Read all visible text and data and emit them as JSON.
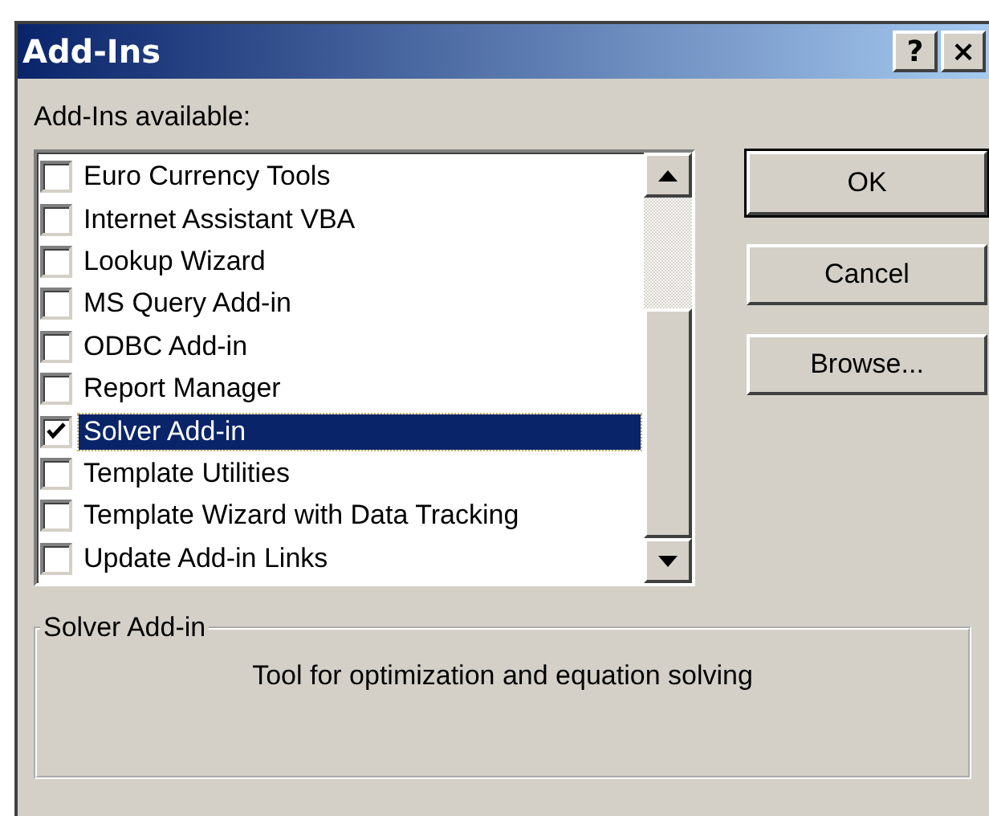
{
  "window": {
    "title": "Add-Ins",
    "title_buttons": [
      "?",
      "×"
    ]
  },
  "list_label": {
    "text": "Add-Ins available:"
  },
  "addins": [
    {
      "name": "Euro Currency Tools",
      "checked": false,
      "selected": false
    },
    {
      "name": "Internet Assistant VBA",
      "checked": false,
      "selected": false
    },
    {
      "name": "Lookup Wizard",
      "checked": false,
      "selected": false
    },
    {
      "name": "MS Query Add-in",
      "checked": false,
      "selected": false
    },
    {
      "name": "ODBC Add-in",
      "checked": false,
      "selected": false
    },
    {
      "name": "Report Manager",
      "checked": false,
      "selected": false
    },
    {
      "name": "Solver Add-in",
      "checked": true,
      "selected": true
    },
    {
      "name": "Template Utilities",
      "checked": false,
      "selected": false
    },
    {
      "name": "Template Wizard with Data Tracking",
      "checked": false,
      "selected": false
    },
    {
      "name": "Update Add-in Links",
      "checked": false,
      "selected": false
    }
  ],
  "buttons": [
    {
      "label": "OK",
      "default": true
    },
    {
      "label": "Cancel",
      "default": false
    },
    {
      "label": "Browse...",
      "default": false
    }
  ],
  "description": {
    "title": "Solver Add-in",
    "text": "Tool for optimization and equation solving"
  }
}
